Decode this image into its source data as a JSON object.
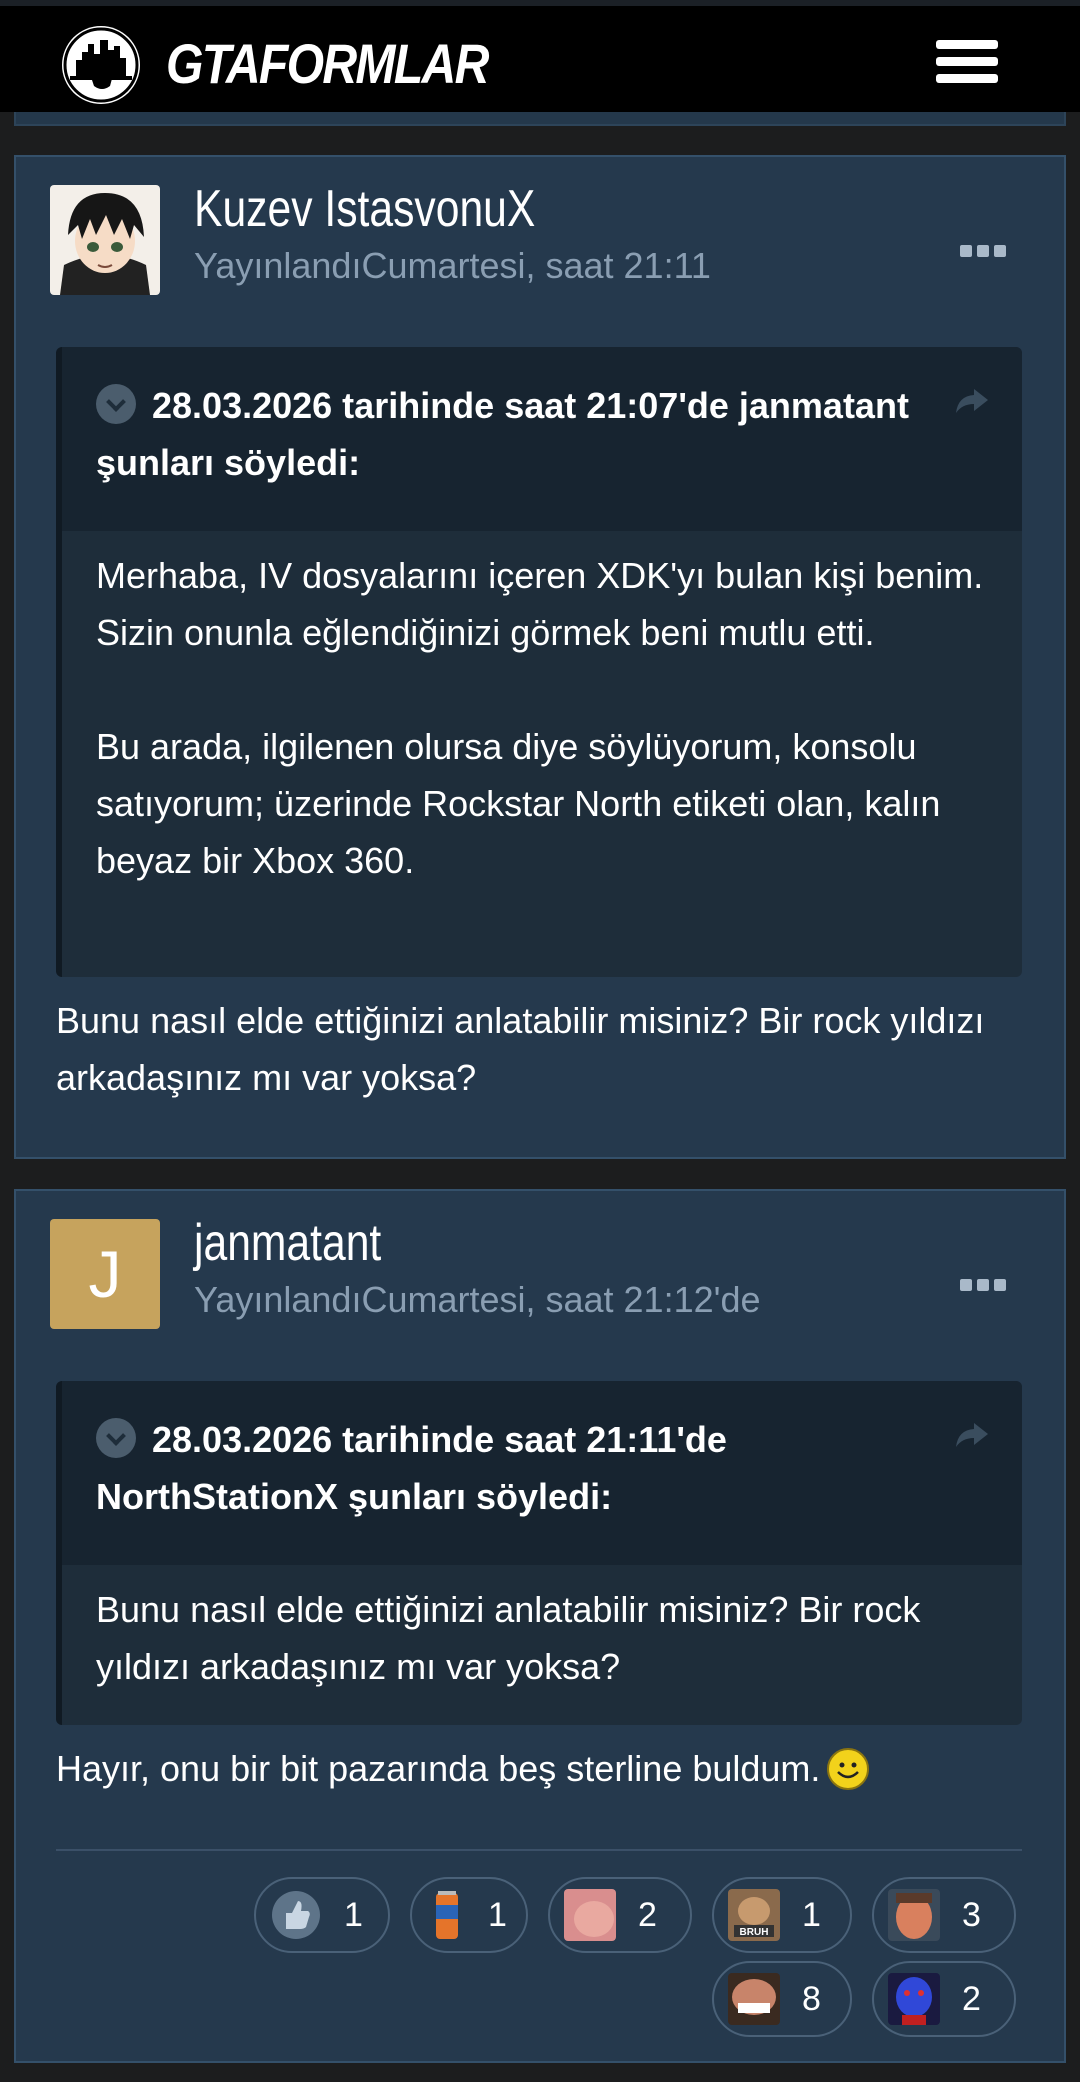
{
  "header": {
    "logo_text": "GTAFORMLAR",
    "logo_icon": "city-skyline-emblem",
    "menu_icon": "hamburger-menu-icon"
  },
  "posts": [
    {
      "author": "Kuzev IstasvonuX",
      "meta": "YayınlandıCumartesi, saat 21:11",
      "avatar": "anime-character-avatar",
      "quote": {
        "header": "28.03.2026 tarihinde saat 21:07'de janmatant şunları söyledi:",
        "paragraphs": [
          "Merhaba, IV dosyalarını içeren XDK'yı bulan kişi benim. Sizin onunla eğlendiğinizi görmek beni mutlu etti.",
          "Bu arada, ilgilenen olursa diye söylüyorum, konsolu satıyorum; üzerinde Rockstar North etiketi olan, kalın beyaz bir Xbox 360."
        ]
      },
      "body": "Bunu nasıl elde ettiğinizi anlatabilir misiniz? Bir rock yıldızı arkadaşınız mı var yoksa?"
    },
    {
      "author": "janmatant",
      "meta": "YayınlandıCumartesi, saat 21:12'de",
      "avatar_letter": "J",
      "quote": {
        "header": "28.03.2026 tarihinde saat 21:11'de NorthStationX şunları söyledi:",
        "paragraphs": [
          "Bunu nasıl elde ettiğinizi anlatabilir misiniz? Bir rock yıldızı arkadaşınız mı var yoksa?"
        ]
      },
      "body": "Hayır, onu bir bit pazarında beş sterline buldum.",
      "reactions": [
        {
          "icon": "thumbs-up-icon",
          "count": "1"
        },
        {
          "icon": "irn-bru-can-icon",
          "count": "1"
        },
        {
          "icon": "face-reaction-icon",
          "count": "2"
        },
        {
          "icon": "bruh-reaction-icon",
          "count": "1"
        },
        {
          "icon": "face-reaction-icon",
          "count": "3"
        },
        {
          "icon": "laughing-face-icon",
          "count": "8"
        },
        {
          "icon": "blue-face-icon",
          "count": "2"
        }
      ]
    }
  ],
  "colors": {
    "page_bg": "#1c1d1e",
    "post_bg": "#25394d",
    "quote_bg": "#1e2d3a",
    "quote_header_bg": "#172430",
    "meta_text": "#8a9eb2",
    "avatar_letter_bg": "#c6a35d"
  }
}
